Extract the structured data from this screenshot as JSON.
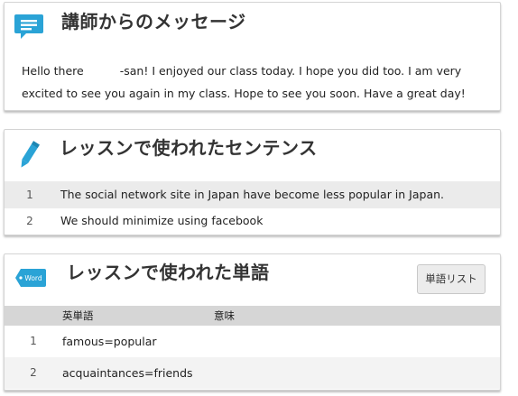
{
  "colors": {
    "icon_blue": "#2aa3d6",
    "header_gray": "#d6d6d6",
    "row_shade": "#ebebeb"
  },
  "message": {
    "icon": "speech-bubble-icon",
    "title": "講師からのメッセージ",
    "greeting": "Hello there",
    "body": "-san! I enjoyed our class today. I hope you did too. I am very excited to see you again in my class. Hope to see you soon. Have a great day!"
  },
  "sentences": {
    "icon": "pencil-icon",
    "title": "レッスンで使われたセンテンス",
    "items": [
      {
        "num": "1",
        "text": "The social network site in Japan have become less popular in Japan."
      },
      {
        "num": "2",
        "text": "We should minimize using facebook"
      }
    ]
  },
  "words": {
    "icon": "word-tag-icon",
    "icon_label": "Word",
    "title": "レッスンで使われた単語",
    "list_button": "単語リスト",
    "columns": {
      "word": "英単語",
      "meaning": "意味"
    },
    "items": [
      {
        "num": "1",
        "word": "famous=popular",
        "meaning": ""
      },
      {
        "num": "2",
        "word": "acquaintances=friends",
        "meaning": ""
      }
    ]
  }
}
